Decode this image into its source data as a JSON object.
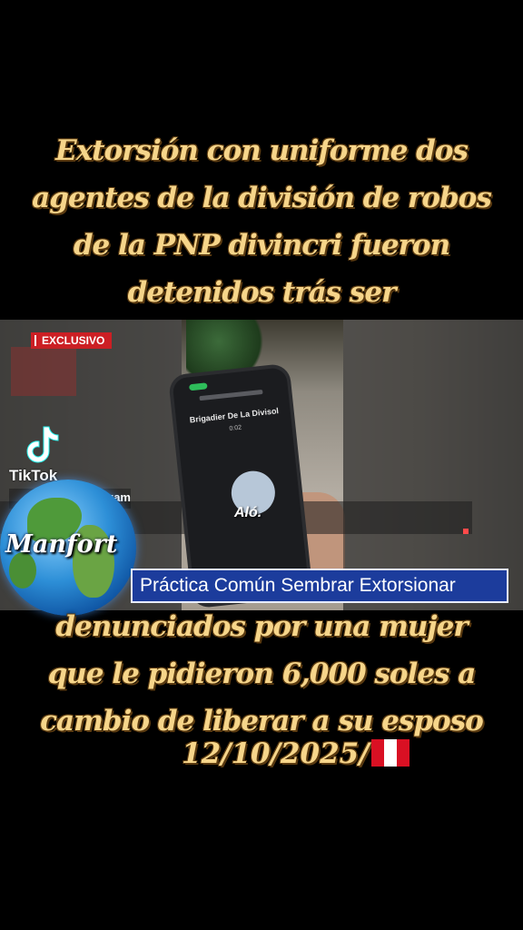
{
  "caption_top": [
    "Extorsión con uniforme dos",
    "agentes de la división de robos",
    "de la PNP divincri fueron",
    "detenidos trás ser"
  ],
  "caption_bottom": [
    "denunciados por una mujer",
    "que le pidieron 6,000 soles a",
    "cambio de liberar a su esposo"
  ],
  "date": "12/10/2025/",
  "video": {
    "badge": "EXCLUSIVO",
    "phone_caller": "Brigadier De La Divisol",
    "phone_timer": "0:02",
    "call_word": "Aló.",
    "banner": "Práctica Común Sembrar Extorsionar"
  },
  "tiktok": {
    "brand": "TikTok",
    "handle": "@...nazam"
  },
  "watermark": "Manfort",
  "colors": {
    "caption": "#f6d58a",
    "banner": "#1c3c9c",
    "badge": "#cc1f24"
  },
  "icons": [
    "tiktok-logo-icon",
    "globe-icon",
    "peru-flag-icon"
  ]
}
